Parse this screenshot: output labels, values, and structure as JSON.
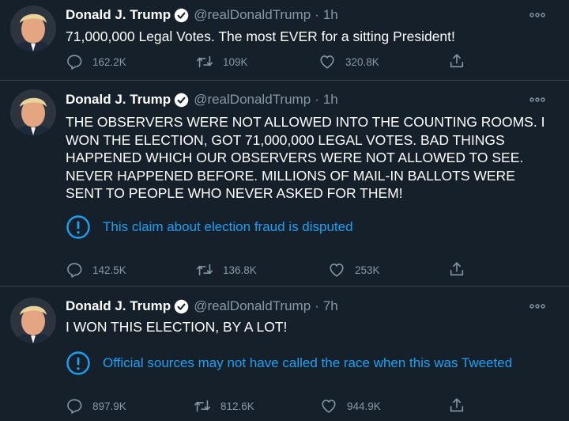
{
  "colors": {
    "background": "#15202b",
    "text": "#ffffff",
    "muted": "#8899a6",
    "accent": "#1da1f2",
    "divider": "#38444d"
  },
  "icons": {
    "verified": "verified-badge-icon",
    "more": "more-dots-icon",
    "reply": "reply-icon",
    "retweet": "retweet-icon",
    "like": "heart-icon",
    "share": "share-icon",
    "notice": "exclamation-circle-icon"
  },
  "tweets": [
    {
      "name": "Donald J. Trump",
      "handle": "@realDonaldTrump",
      "separator": "·",
      "time": "1h",
      "text": "71,000,000 Legal Votes. The most EVER for a sitting President!",
      "notice": "",
      "replies": "162.2K",
      "retweets": "109K",
      "likes": "320.8K"
    },
    {
      "name": "Donald J. Trump",
      "handle": "@realDonaldTrump",
      "separator": "·",
      "time": "1h",
      "text": "THE OBSERVERS WERE NOT ALLOWED INTO THE COUNTING ROOMS. I WON THE ELECTION, GOT 71,000,000 LEGAL VOTES. BAD THINGS HAPPENED WHICH OUR OBSERVERS WERE NOT ALLOWED TO SEE. NEVER HAPPENED BEFORE. MILLIONS OF MAIL-IN BALLOTS WERE SENT TO PEOPLE WHO NEVER ASKED FOR THEM!",
      "notice": "This claim about election fraud is disputed",
      "replies": "142.5K",
      "retweets": "136.8K",
      "likes": "253K"
    },
    {
      "name": "Donald J. Trump",
      "handle": "@realDonaldTrump",
      "separator": "·",
      "time": "7h",
      "text": "I WON THIS ELECTION, BY A LOT!",
      "notice": "Official sources may not have called the race when this was Tweeted",
      "replies": "897.9K",
      "retweets": "812.6K",
      "likes": "944.9K"
    }
  ]
}
